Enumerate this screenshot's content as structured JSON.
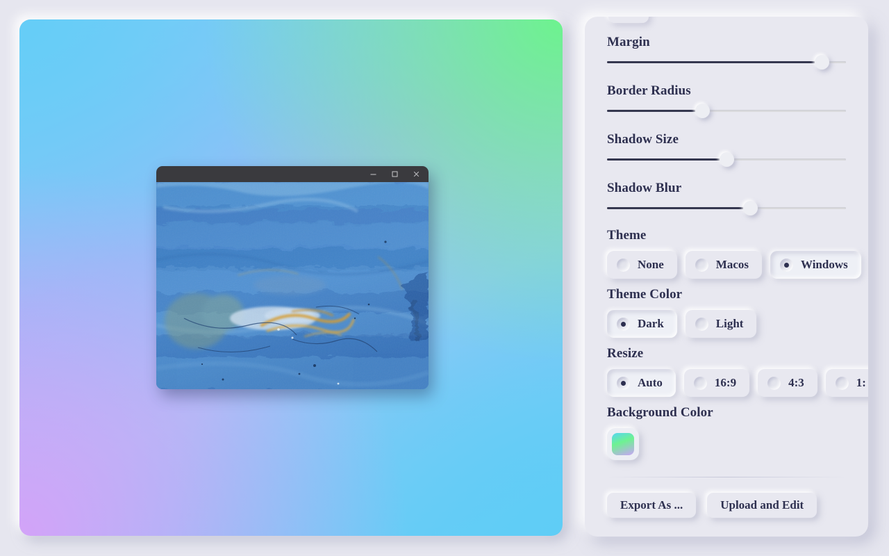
{
  "app": {
    "background_color": "#e6e6ef",
    "accent_color": "#2e3050"
  },
  "canvas": {
    "name": "preview-canvas",
    "background_color_label": "gradient",
    "gradient_stops": [
      "#65cdf7",
      "#6df38e",
      "#a5b6f7",
      "#d3a3f8",
      "#5fcdf6"
    ],
    "mock_window": {
      "theme": "Windows",
      "theme_color": "Dark",
      "titlebar_color": "#3a3a3e",
      "controls": [
        {
          "icon": "minimize-icon",
          "label": "–"
        },
        {
          "icon": "maximize-icon",
          "label": "□"
        },
        {
          "icon": "close-icon",
          "label": "×"
        }
      ],
      "image_alt": "Blue abstract acrylic painting with gold brushstrokes"
    }
  },
  "panel": {
    "name": "settings-panel",
    "sliders": [
      {
        "label": "Margin",
        "value": 90,
        "min": 0,
        "max": 100
      },
      {
        "label": "Border Radius",
        "value": 40,
        "min": 0,
        "max": 100
      },
      {
        "label": "Shadow Size",
        "value": 50,
        "min": 0,
        "max": 100
      },
      {
        "label": "Shadow Blur",
        "value": 60,
        "min": 0,
        "max": 100
      }
    ],
    "theme": {
      "label": "Theme",
      "options": [
        {
          "label": "None",
          "selected": false
        },
        {
          "label": "Macos",
          "selected": false
        },
        {
          "label": "Windows",
          "selected": true
        }
      ]
    },
    "theme_color": {
      "label": "Theme Color",
      "options": [
        {
          "label": "Dark",
          "selected": true
        },
        {
          "label": "Light",
          "selected": false
        }
      ]
    },
    "resize": {
      "label": "Resize",
      "options": [
        {
          "label": "Auto",
          "selected": true
        },
        {
          "label": "16:9",
          "selected": false
        },
        {
          "label": "4:3",
          "selected": false
        },
        {
          "label": "1:",
          "selected": false
        }
      ]
    },
    "background_color": {
      "label": "Background Color",
      "swatch_gradient": [
        "#56d6f2",
        "#6ef291",
        "#c9a3f7"
      ]
    },
    "footer": {
      "export_label": "Export As ...",
      "upload_label": "Upload and Edit"
    }
  }
}
